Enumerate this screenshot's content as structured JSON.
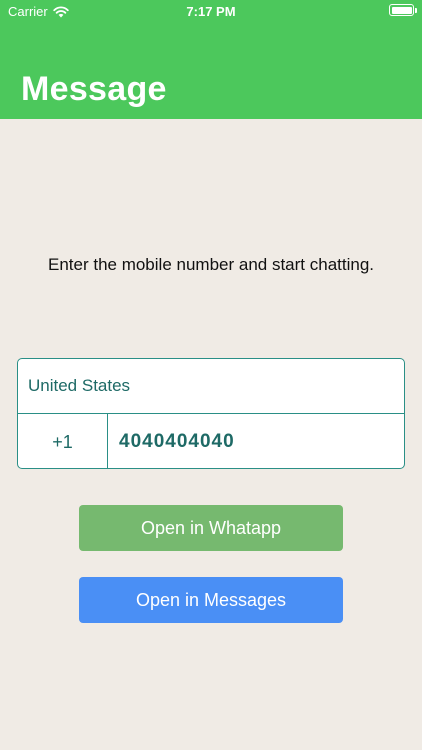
{
  "status_bar": {
    "carrier": "Carrier",
    "time": "7:17 PM",
    "wifi_icon": "wifi-icon",
    "battery_icon": "battery-icon"
  },
  "nav": {
    "title": "Message"
  },
  "prompt": "Enter the mobile number and start chatting.",
  "form": {
    "country": "United States",
    "dial_code": "+1",
    "phone_value": "4040404040"
  },
  "buttons": {
    "whatsapp_label": "Open in Whatapp",
    "messages_label": "Open in Messages"
  },
  "colors": {
    "header": "#4cc85c",
    "background": "#f0ebe5",
    "accent_teal": "#2a8f86",
    "whatsapp_button": "#76b96f",
    "messages_button": "#4a8ff5"
  }
}
